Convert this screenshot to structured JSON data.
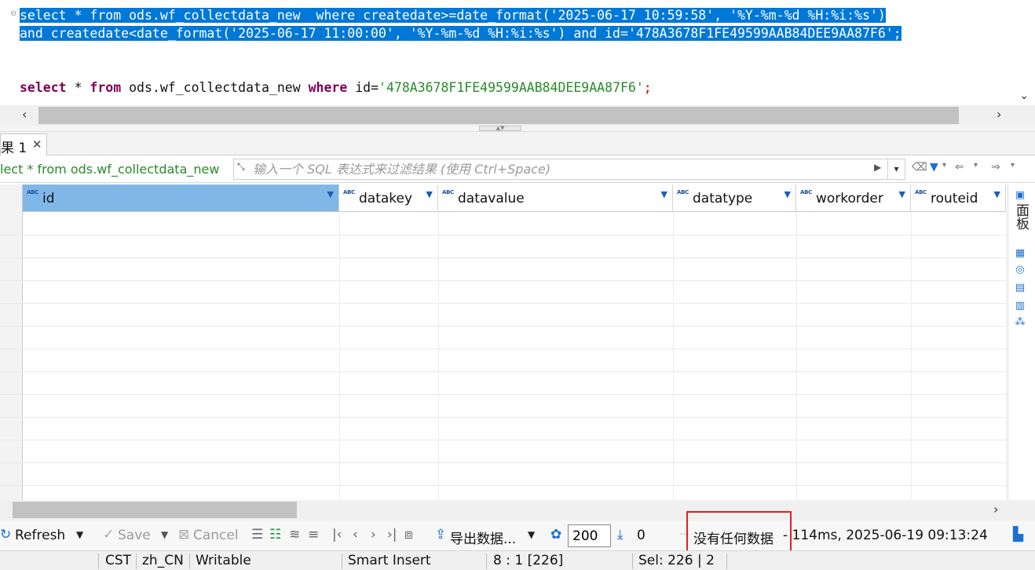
{
  "editor": {
    "line1": {
      "kw_select": "select",
      "star": " * ",
      "kw_from": "from",
      "table": " ods.wf_collectdata_new  ",
      "kw_where": "where",
      "cond_a": " createdate>=",
      "fn": "date_format",
      "open": "(",
      "date1": "'2025-06-17 10:59:58'",
      "comma": ", ",
      "fmt": "'%Y-%m-%d %H:%i:%s'",
      "close": ")"
    },
    "line2": {
      "kw_and1": "and",
      "cond_b": " createdate<",
      "fn": "date_format",
      "open": "(",
      "date2": "'2025-06-17 11:00:00'",
      "comma": ", ",
      "fmt": "'%Y-%m-%d %H:%i:%s'",
      "close": ") ",
      "kw_and2": "and",
      "cond_c": " id=",
      "id": "'478A3678F1FE49599AAB84DEE9AA87F6'",
      "semi": ";"
    },
    "line3": {
      "kw_select": "select",
      "star": " * ",
      "kw_from": "from",
      "table": " ods.wf_collectdata_new ",
      "kw_where": "where",
      "cond": " id=",
      "id": "'478A3678F1FE49599AAB84DEE9AA87F6'",
      "semi": ";"
    }
  },
  "result_tab": {
    "label": "果 1",
    "close": "✕"
  },
  "filter": {
    "query_text": "lect * from ods.wf_collectdata_new",
    "placeholder": "输入一个 SQL 表达式来过滤结果 (使用 Ctrl+Space)"
  },
  "grid": {
    "columns": [
      {
        "name": "id",
        "type": "ABC"
      },
      {
        "name": "datakey",
        "type": "ABC"
      },
      {
        "name": "datavalue",
        "type": "ABC"
      },
      {
        "name": "datatype",
        "type": "ABC"
      },
      {
        "name": "workorder",
        "type": "ABC"
      },
      {
        "name": "routeid",
        "type": "ABC"
      }
    ]
  },
  "side_panel": {
    "label": "面板"
  },
  "toolbar": {
    "refresh": "Refresh",
    "save": "Save",
    "cancel": "Cancel",
    "export": "导出数据...",
    "limit": "200",
    "count": "0",
    "no_data": "没有任何数据",
    "timing": "- 114ms, 2025-06-19 09:13:24"
  },
  "statusbar": {
    "timezone": "CST",
    "locale": "zh_CN",
    "mode": "Writable",
    "insert": "Smart Insert",
    "position": "8 : 1 [226]",
    "selection": "Sel: 226 | 2"
  },
  "colors": {
    "selection": "#0078d7",
    "keyword": "#7f0055",
    "string": "#2a8a2a",
    "highlight_box": "#e02020",
    "active_header": "#7fb8e8"
  }
}
